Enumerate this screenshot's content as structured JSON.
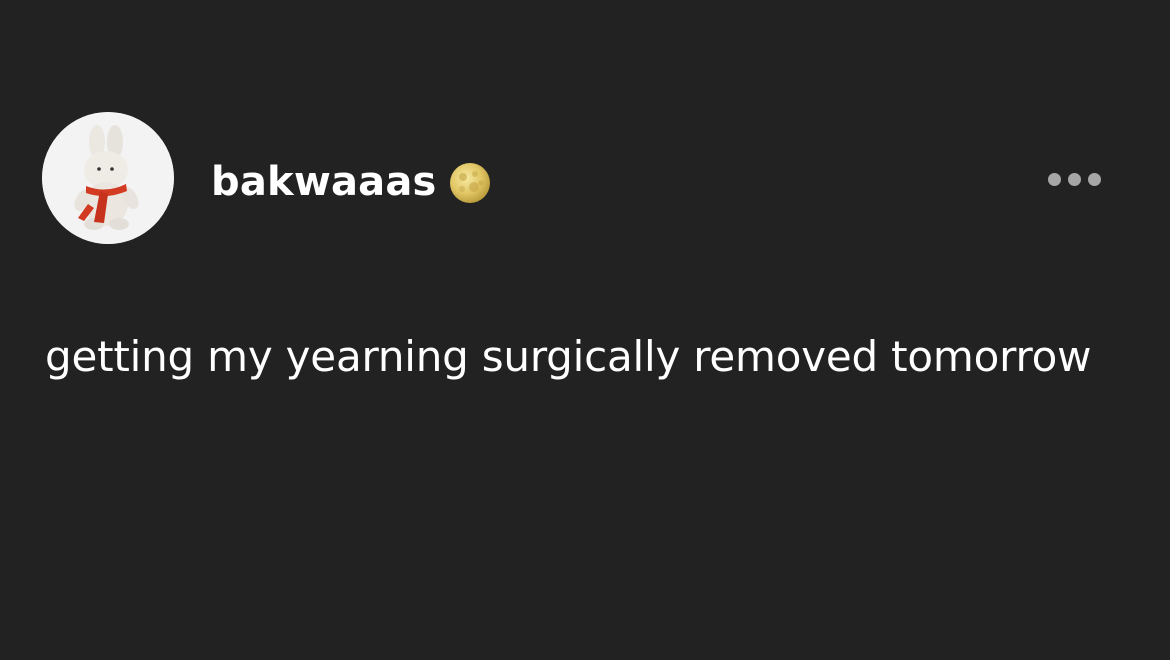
{
  "post": {
    "author": {
      "username": "bakwaaas",
      "avatar_icon": "bunny-plush-with-red-scarf",
      "badge_icon": "full-moon-emoji"
    },
    "menu_icon": "more-horizontal-icon",
    "text": "getting my yearning surgically removed tomorrow"
  },
  "colors": {
    "background": "#222222",
    "text": "#ffffff",
    "menu_dots": "#a6a6a6",
    "avatar_background": "#f2f2f2",
    "scarf": "#d23a22"
  }
}
